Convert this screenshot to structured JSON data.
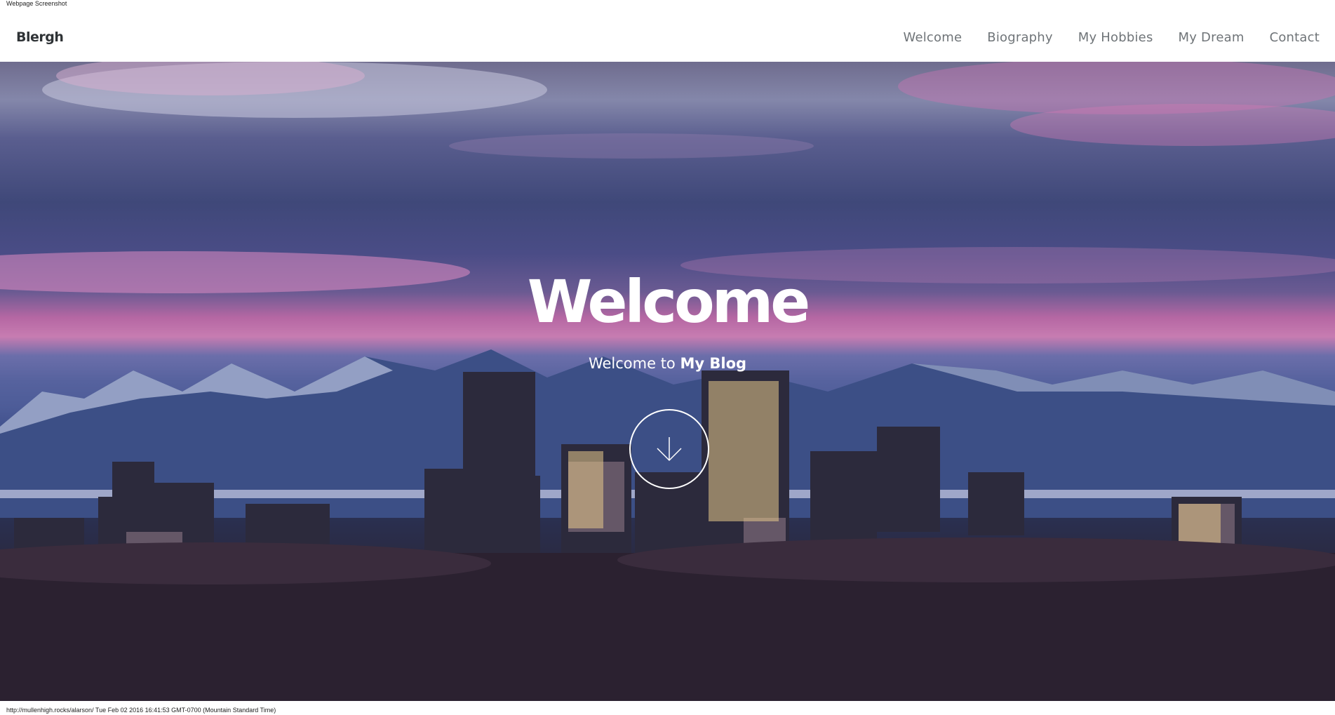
{
  "screenshot_label": "Webpage Screenshot",
  "navbar": {
    "brand": "Blergh",
    "links": [
      {
        "label": "Welcome"
      },
      {
        "label": "Biography"
      },
      {
        "label": "My Hobbies"
      },
      {
        "label": "My Dream"
      },
      {
        "label": "Contact"
      }
    ]
  },
  "hero": {
    "title": "Welcome",
    "subtitle_prefix": "Welcome to ",
    "subtitle_strong": "My Blog",
    "scroll_icon": "arrow-down-icon"
  },
  "footer": {
    "url_and_time": "http://mullenhigh.rocks/alarson/ Tue Feb 02 2016 16:41:53 GMT-0700 (Mountain Standard Time)"
  },
  "colors": {
    "nav_text": "#6f7478",
    "brand_text": "#2f3336",
    "hero_text": "#ffffff"
  }
}
